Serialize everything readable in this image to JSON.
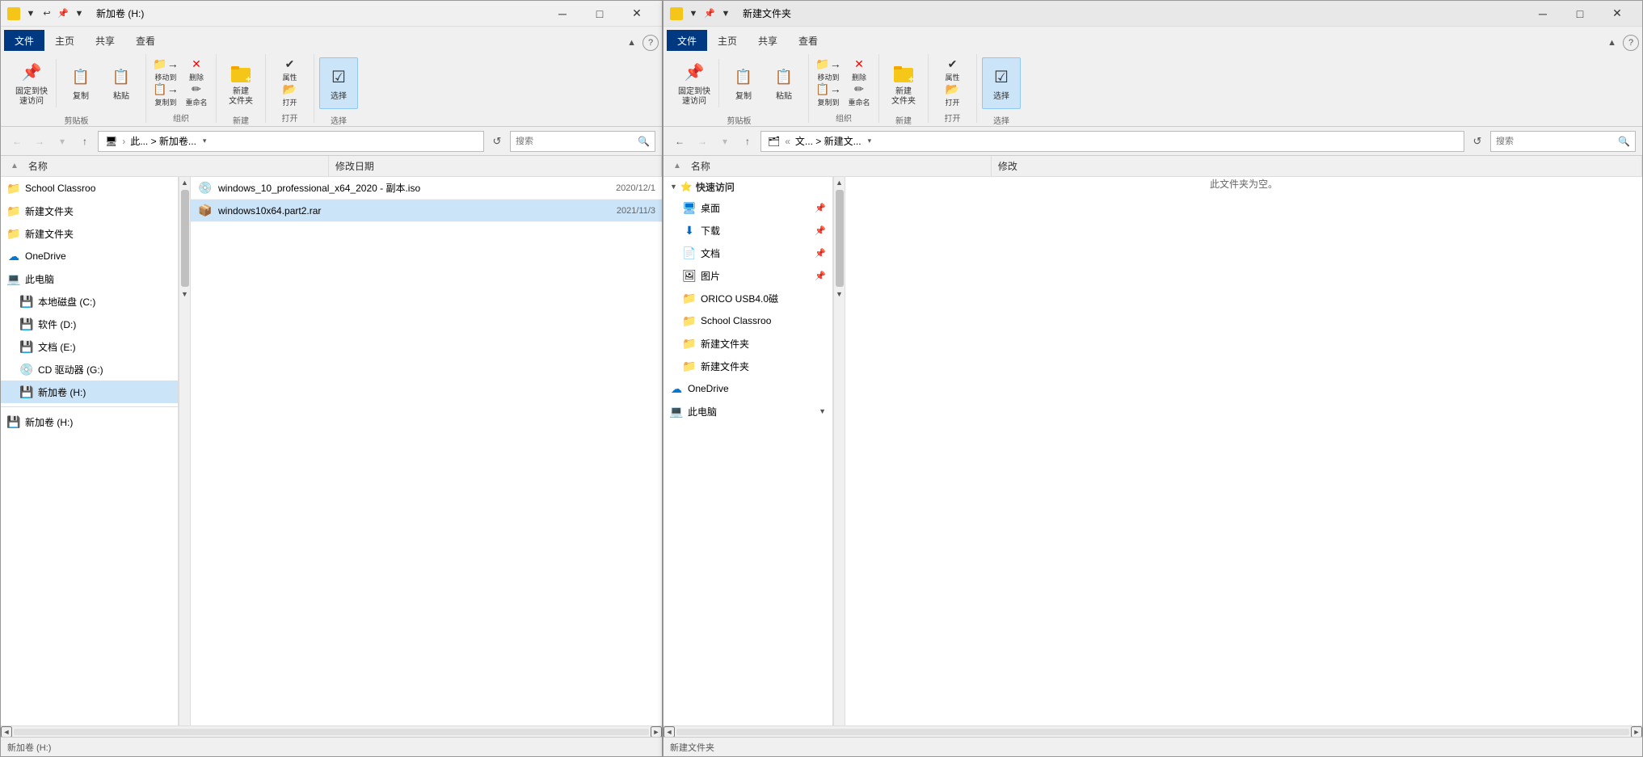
{
  "window_left": {
    "title": "新加卷 (H:)",
    "tabs": [
      "文件",
      "主页",
      "共享",
      "查看"
    ],
    "active_tab": "主页",
    "ribbon": {
      "groups": [
        {
          "label": "剪贴板",
          "buttons": [
            {
              "id": "pin",
              "label": "固定到快\n速访问",
              "icon": "📌"
            },
            {
              "id": "copy",
              "label": "复制",
              "icon": "📋"
            },
            {
              "id": "paste",
              "label": "粘贴",
              "icon": "📋"
            }
          ]
        },
        {
          "label": "组织",
          "buttons": [
            {
              "id": "move",
              "label": "移动",
              "icon": "📁"
            },
            {
              "id": "copy2",
              "label": "复制",
              "icon": "📁"
            },
            {
              "id": "delete",
              "label": "删除",
              "icon": "✕"
            },
            {
              "id": "rename",
              "label": "重命名",
              "icon": "✏️"
            }
          ]
        },
        {
          "label": "新建",
          "buttons": [
            {
              "id": "new-folder",
              "label": "新建\n文件夹",
              "icon": "📁"
            }
          ]
        },
        {
          "label": "打开",
          "buttons": [
            {
              "id": "properties",
              "label": "属性",
              "icon": "📄"
            },
            {
              "id": "open",
              "label": "",
              "icon": "📂"
            }
          ]
        },
        {
          "label": "选择",
          "buttons": [
            {
              "id": "select",
              "label": "选择",
              "icon": "☑"
            }
          ]
        }
      ]
    },
    "address_bar": {
      "path": "此...  >  新加卷...",
      "placeholder": "搜索"
    },
    "columns": {
      "name": "名称",
      "modified": "修改日期"
    },
    "nav_items": [
      {
        "id": "school",
        "label": "School Classroo",
        "icon": "folder",
        "indent": 0
      },
      {
        "id": "new-folder-1",
        "label": "新建文件夹",
        "icon": "folder",
        "indent": 0
      },
      {
        "id": "new-folder-2",
        "label": "新建文件夹",
        "icon": "folder",
        "indent": 0
      },
      {
        "id": "onedrive",
        "label": "OneDrive",
        "icon": "cloud",
        "indent": 0
      },
      {
        "id": "this-pc",
        "label": "此电脑",
        "icon": "computer",
        "indent": 0
      },
      {
        "id": "drive-c",
        "label": "本地磁盘 (C:)",
        "icon": "drive",
        "indent": 1
      },
      {
        "id": "drive-d",
        "label": "软件 (D:)",
        "icon": "drive",
        "indent": 1
      },
      {
        "id": "drive-e",
        "label": "文档 (E:)",
        "icon": "drive",
        "indent": 1
      },
      {
        "id": "drive-g",
        "label": "CD 驱动器 (G:)",
        "icon": "cd",
        "indent": 1
      },
      {
        "id": "drive-h",
        "label": "新加卷 (H:)",
        "icon": "drive",
        "indent": 1
      },
      {
        "id": "new-vol",
        "label": "新加卷 (H:)",
        "icon": "drive",
        "indent": 0
      }
    ],
    "files": [
      {
        "name": "windows_10_professional_x64_2020 - 副本.iso",
        "date": "2020/12/1",
        "icon": "iso",
        "selected": false
      },
      {
        "name": "windows10x64.part2.rar",
        "date": "2021/11/3",
        "icon": "rar",
        "selected": true
      }
    ]
  },
  "window_right": {
    "title": "新建文件夹",
    "tabs": [
      "文件",
      "主页",
      "共享",
      "查看"
    ],
    "active_tab": "文件",
    "address_bar": {
      "path": "文...  >  新建文...",
      "placeholder": "搜索"
    },
    "columns": {
      "name": "名称",
      "modified": "修改"
    },
    "nav_items": [
      {
        "id": "quick-access",
        "label": "快速访问",
        "icon": "star",
        "indent": 0
      },
      {
        "id": "desktop",
        "label": "桌面",
        "icon": "desktop",
        "indent": 1,
        "pinned": true
      },
      {
        "id": "downloads",
        "label": "下载",
        "icon": "download",
        "indent": 1,
        "pinned": true
      },
      {
        "id": "documents",
        "label": "文档",
        "icon": "doc",
        "indent": 1,
        "pinned": true
      },
      {
        "id": "pictures",
        "label": "图片",
        "icon": "pic",
        "indent": 1,
        "pinned": true
      },
      {
        "id": "orico",
        "label": "ORICO USB4.0磁",
        "icon": "folder",
        "indent": 1
      },
      {
        "id": "school2",
        "label": "School Classroo",
        "icon": "folder",
        "indent": 1
      },
      {
        "id": "new-folder-3",
        "label": "新建文件夹",
        "icon": "folder",
        "indent": 1
      },
      {
        "id": "new-folder-4",
        "label": "新建文件夹",
        "icon": "folder",
        "indent": 1
      },
      {
        "id": "onedrive2",
        "label": "OneDrive",
        "icon": "cloud",
        "indent": 0
      },
      {
        "id": "this-pc2",
        "label": "此电脑",
        "icon": "computer",
        "indent": 0,
        "expand": true
      }
    ],
    "empty_message": "此文件夹为空。",
    "files": []
  },
  "icons": {
    "folder": "🗂",
    "cloud": "☁",
    "computer": "💻",
    "drive": "💾",
    "cd": "💿",
    "star": "⭐",
    "desktop": "🖥",
    "download": "⬇",
    "doc": "📄",
    "pic": "🖼",
    "iso": "💿",
    "rar": "📦",
    "pin": "📌"
  }
}
